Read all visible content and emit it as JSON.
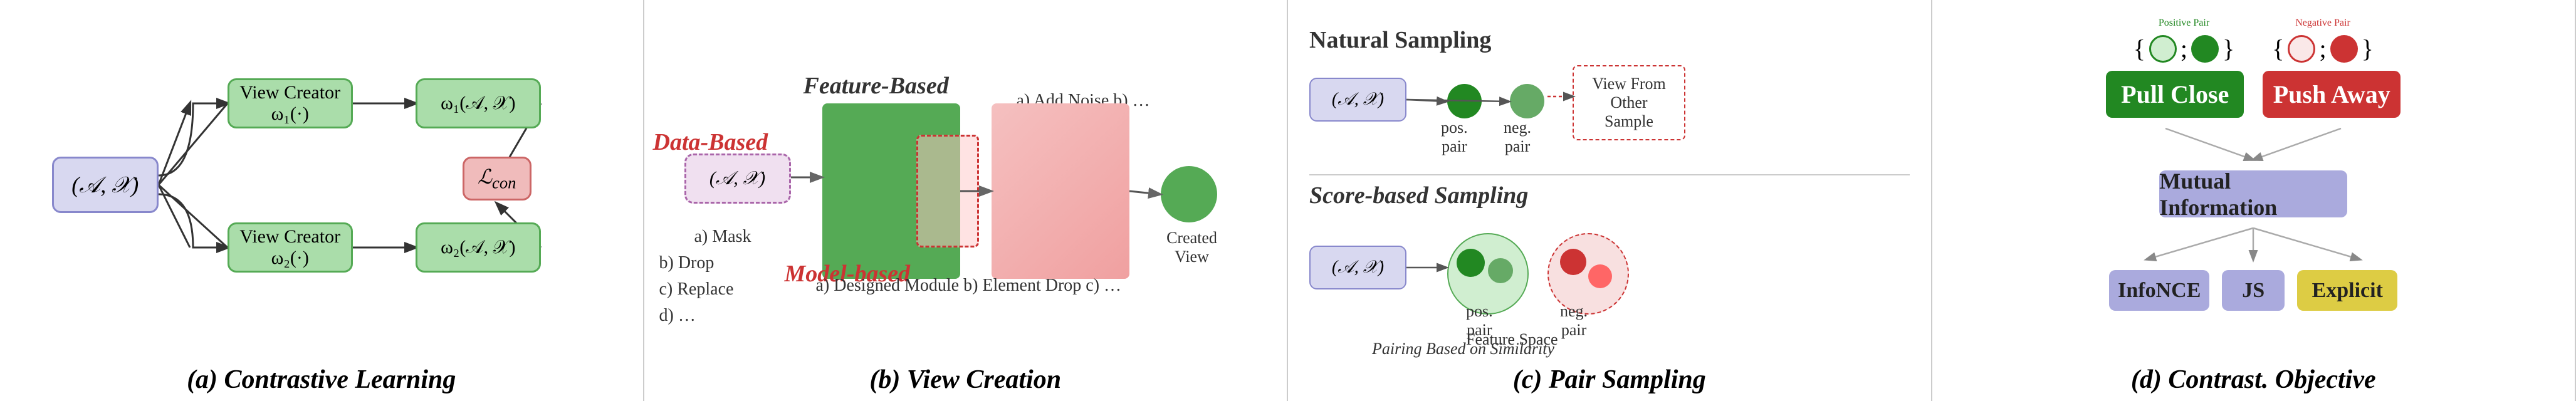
{
  "panelA": {
    "title": "(a) Contrastive Learning",
    "input_label": "(𝒜, 𝒳)",
    "vc_top_line1": "View Creator",
    "vc_top_line2": "ω₁(·)",
    "vc_bot_line1": "View Creator",
    "vc_bot_line2": "ω₂(·)",
    "out_top": "ω₁(𝒜, 𝒳)",
    "out_bot": "ω₂(𝒜, 𝒳)",
    "loss": "ℒcon"
  },
  "panelB": {
    "title": "(b) View Creation",
    "input_label": "(𝒜, 𝒳)",
    "feature_based": "Feature-Based",
    "feature_text": "a) Add Noise b) …",
    "data_based": "Data-Based",
    "data_text": "a) Mask\nb) Drop\nc) Replace\nd) …",
    "model_based": "Model-based",
    "model_text": "a) Designed Module\nb) Element Drop c) …",
    "created_view": "Created View"
  },
  "panelC": {
    "title": "(c) Pair Sampling",
    "natural_title": "Natural Sampling",
    "score_title": "Score-based Sampling",
    "input_label": "(𝒜, 𝒳)",
    "pos_pair": "pos.\npair",
    "neg_pair": "neg.\npair",
    "view_from_other": "View From\nOther\nSample",
    "pairing_label": "Pairing Based on Similarity",
    "pos_pair2": "pos.\npair",
    "neg_pair2": "neg.\npair",
    "feature_space": "Feature Space"
  },
  "panelD": {
    "title": "(d) Contrast. Objective",
    "positive_pair_label": "Positive Pair",
    "negative_pair_label": "Negative Pair",
    "pull_close": "Pull Close",
    "push_away": "Push Away",
    "mutual_information": "Mutual Information",
    "infonce": "InfoNCE",
    "js": "JS",
    "explicit": "Explicit"
  }
}
